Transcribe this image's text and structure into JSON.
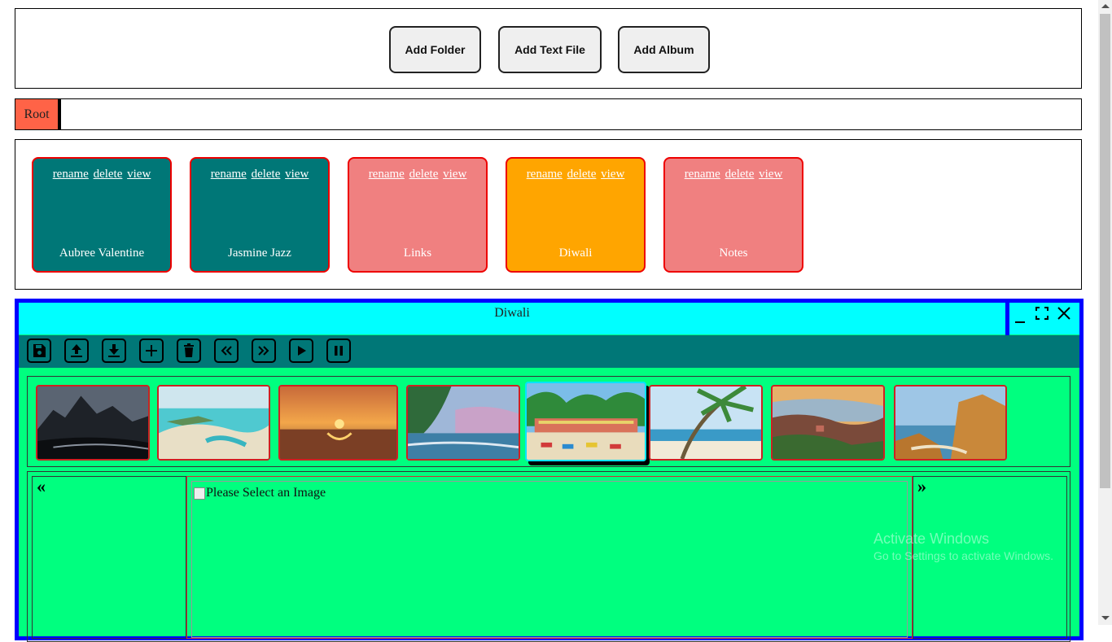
{
  "toolbar": {
    "add_folder": "Add Folder",
    "add_text_file": "Add Text File",
    "add_album": "Add Album"
  },
  "breadcrumb": {
    "root": "Root"
  },
  "items": [
    {
      "name": "Aubree Valentine",
      "color": "#007777",
      "rename": "rename",
      "delete": "delete",
      "view": "view"
    },
    {
      "name": "Jasmine Jazz",
      "color": "#007777",
      "rename": "rename",
      "delete": "delete",
      "view": "view"
    },
    {
      "name": "Links",
      "color": "#f08080",
      "rename": "rename",
      "delete": "delete",
      "view": "view"
    },
    {
      "name": "Diwali",
      "color": "#ffa500",
      "rename": "rename",
      "delete": "delete",
      "view": "view"
    },
    {
      "name": "Notes",
      "color": "#f08080",
      "rename": "rename",
      "delete": "delete",
      "view": "view"
    }
  ],
  "viewer": {
    "title": "Diwali",
    "controls": [
      "minimize-icon",
      "maximize-icon",
      "close-icon"
    ],
    "tools": [
      "save-icon",
      "upload-icon",
      "download-icon",
      "plus-icon",
      "trash-icon",
      "rewind-icon",
      "fast-forward-icon",
      "play-icon",
      "pause-icon"
    ],
    "thumbnails": [
      "mountain-beach",
      "tropical-island",
      "sunset-beach",
      "palm-shore-dusk",
      "beach-resort",
      "palm-tree-beach",
      "coastal-town",
      "rocky-cliffs"
    ],
    "selected_thumbnail": 4,
    "prev": "«",
    "next": "»",
    "image_alt": "Please Select an Image"
  },
  "watermark": {
    "line1": "Activate Windows",
    "line2": "Go to Settings to activate Windows."
  },
  "colors": {
    "viewer_border": "#0000ff",
    "title_bar": "#00ffff",
    "viewer_bg": "#00ff7f",
    "toolbar_bg": "#007777",
    "root_crumb": "#ff6347"
  }
}
